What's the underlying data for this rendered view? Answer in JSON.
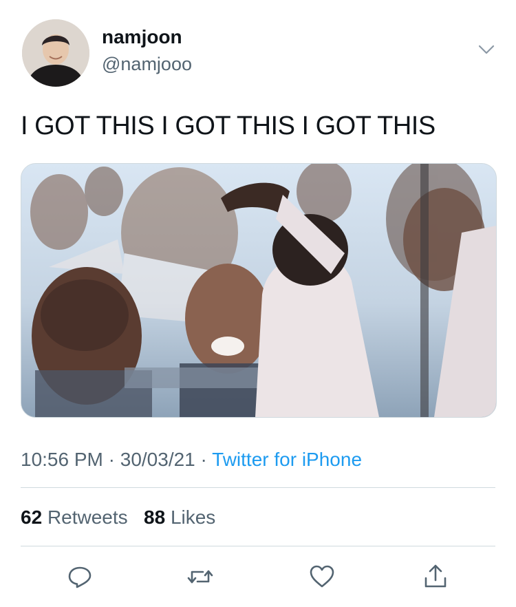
{
  "user": {
    "display_name": "namjoon",
    "handle": "@namjooo"
  },
  "tweet": {
    "text": "I GOT THIS I GOT THIS I GOT THIS",
    "time": "10:56 PM",
    "date": "30/03/21",
    "source": "Twitter for iPhone",
    "separator": "·"
  },
  "stats": {
    "retweets_count": "62",
    "retweets_label": "Retweets",
    "likes_count": "88",
    "likes_label": "Likes"
  },
  "icons": {
    "menu": "chevron-down-icon",
    "reply": "reply-icon",
    "retweet": "retweet-icon",
    "like": "heart-icon",
    "share": "share-icon"
  },
  "colors": {
    "link": "#1d9bf0",
    "secondary_text": "#536471",
    "divider": "#cfd9de",
    "icon": "#536471"
  }
}
